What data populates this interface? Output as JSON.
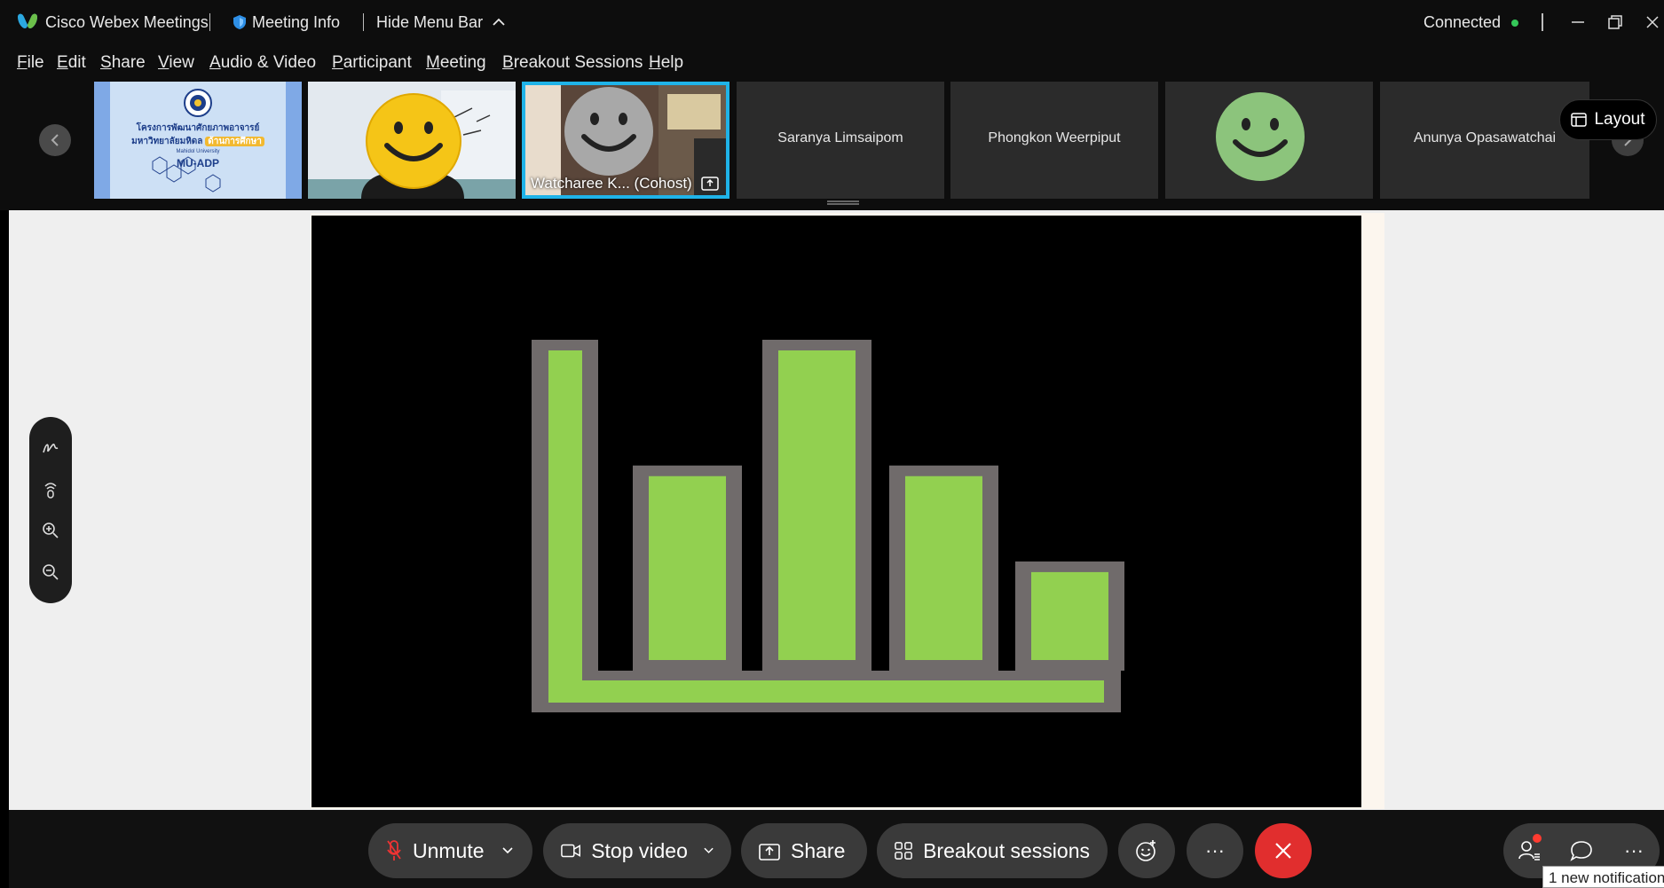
{
  "titlebar": {
    "app_name": "Cisco Webex Meetings",
    "meeting_info": "Meeting Info",
    "hide_menu_bar": "Hide Menu Bar",
    "status": "Connected"
  },
  "menu": {
    "items": [
      {
        "accel": "F",
        "rest": "ile"
      },
      {
        "accel": "E",
        "rest": "dit"
      },
      {
        "accel": "S",
        "rest": "hare"
      },
      {
        "accel": "V",
        "rest": "iew"
      },
      {
        "accel": "A",
        "rest": "udio & Video"
      },
      {
        "accel": "P",
        "rest": "articipant"
      },
      {
        "accel": "M",
        "rest": "eeting"
      },
      {
        "accel": "B",
        "rest": "reakout Sessions"
      },
      {
        "accel": "H",
        "rest": "elp"
      }
    ]
  },
  "filmstrip": {
    "banner": {
      "line1": "โครงการพัฒนาศักยภาพอาจารย์",
      "line2": "มหาวิทยาลัยมหิดล",
      "highlight": "ด้านการศึกษา",
      "university": "Mahidol University",
      "program": "MU-ADP"
    },
    "active_caption": "Watcharee K...  (Cohost)",
    "participants": [
      {
        "name": "Saranya Limsaipom"
      },
      {
        "name": "Phongkon Weerpiput"
      },
      {
        "name": "Anunya Opasawatchai"
      }
    ],
    "layout_label": "Layout"
  },
  "shared_content": {
    "icon": "bar-chart-icon",
    "colors": {
      "bar_fill": "#92d050",
      "bar_border": "#706b6b",
      "background": "#000000"
    },
    "bar_levels": [
      1.0,
      0.62,
      1.0,
      0.62,
      0.33
    ]
  },
  "controls": {
    "unmute": "Unmute",
    "stop_video": "Stop video",
    "share": "Share",
    "breakout": "Breakout sessions",
    "more": "···",
    "notification": "1 new notification"
  }
}
